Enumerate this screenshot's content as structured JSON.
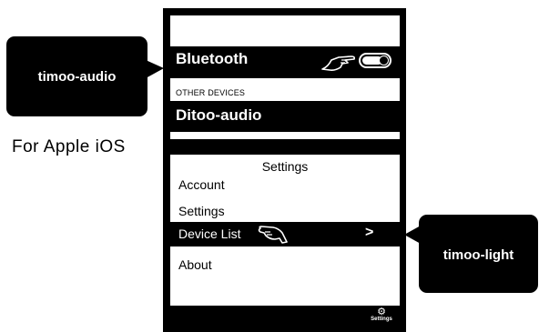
{
  "callouts": {
    "left": "timoo-audio",
    "right": "timoo-light"
  },
  "caption": "For Apple iOS",
  "bluetooth_screen": {
    "bluetooth_label": "Bluetooth",
    "toggle_state": "on",
    "other_devices_header": "OTHER DEVICES",
    "device_name": "Ditoo-audio"
  },
  "settings_screen": {
    "title": "Settings",
    "items": [
      "Account",
      "Settings",
      "Device List",
      "About"
    ],
    "selected_item_chevron": ">",
    "tab_label": "Settings",
    "tab_icon": "gear-icon"
  }
}
